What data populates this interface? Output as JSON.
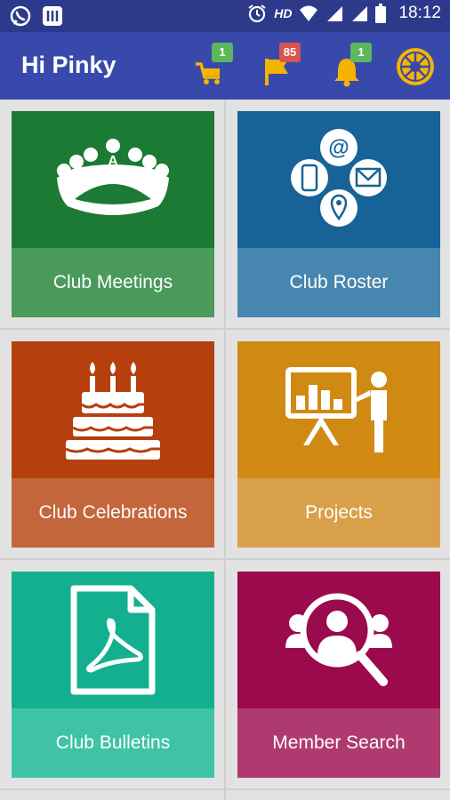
{
  "status": {
    "network": "HD",
    "time": "18:12"
  },
  "header": {
    "title": "Hi Pinky",
    "cart_badge": "1",
    "flag_badge": "85",
    "bell_badge": "1"
  },
  "colors": {
    "statusbar": "#2d3a8c",
    "appbar": "#3949ab",
    "badge_green": "#5cb85c",
    "badge_red": "#d9534f"
  },
  "tiles": [
    {
      "label": "Club Meetings",
      "icon": "meeting-table-icon",
      "color": "#1b7a34",
      "label_color": "#4a9a5c"
    },
    {
      "label": "Club Roster",
      "icon": "contact-roster-icon",
      "color": "#176296",
      "label_color": "#4786ae"
    },
    {
      "label": "Club Celebrations",
      "icon": "birthday-cake-icon",
      "color": "#b5400e",
      "label_color": "#c4663b"
    },
    {
      "label": "Projects",
      "icon": "presentation-icon",
      "color": "#d08a13",
      "label_color": "#d9a04a"
    },
    {
      "label": "Club Bulletins",
      "icon": "pdf-document-icon",
      "color": "#13b08f",
      "label_color": "#3fc3a6"
    },
    {
      "label": "Member Search",
      "icon": "member-search-icon",
      "color": "#9b0a4c",
      "label_color": "#af3a6f"
    }
  ]
}
